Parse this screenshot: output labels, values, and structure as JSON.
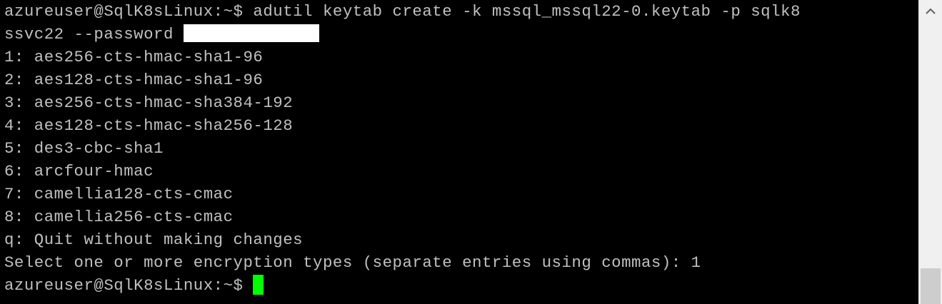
{
  "terminal": {
    "command_line_1": "azureuser@SqlK8sLinux:~$ adutil keytab create -k mssql_mssql22-0.keytab -p sqlk8",
    "command_line_2": "ssvc22 --password ",
    "options": [
      "1: aes256-cts-hmac-sha1-96",
      "2: aes128-cts-hmac-sha1-96",
      "3: aes256-cts-hmac-sha384-192",
      "4: aes128-cts-hmac-sha256-128",
      "5: des3-cbc-sha1",
      "6: arcfour-hmac",
      "7: camellia128-cts-cmac",
      "8: camellia256-cts-cmac"
    ],
    "quit_option": "q: Quit without making changes",
    "select_prompt": "Select one or more encryption types (separate entries using commas): 1",
    "final_prompt": "azureuser@SqlK8sLinux:~$ ",
    "colors": {
      "background": "#000000",
      "text": "#c0c0c0",
      "cursor": "#00ff00",
      "redaction": "#ffffff"
    }
  },
  "scrollbar": {
    "up_icon": "chevron-up-icon"
  }
}
